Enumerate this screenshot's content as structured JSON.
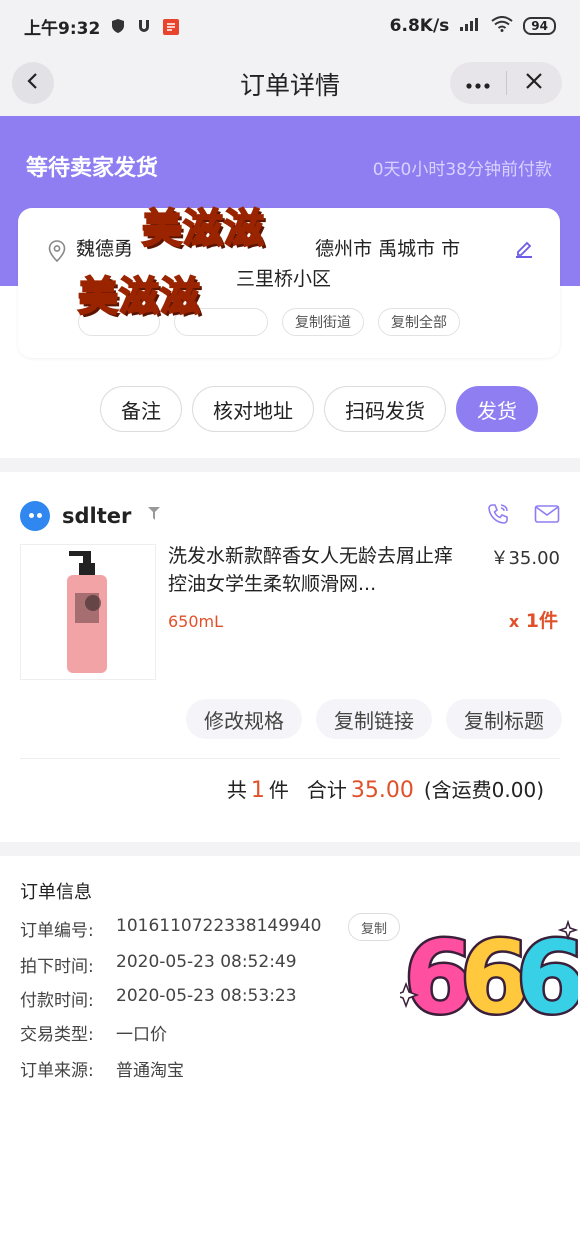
{
  "statusbar": {
    "time": "上午9:32",
    "network": "6.8K/s",
    "battery": "94"
  },
  "nav": {
    "title": "订单详情"
  },
  "order_status": {
    "title": "等待卖家发货",
    "paid_ago": "0天0小时38分钟前付款"
  },
  "address": {
    "line1": "魏德勇 ",
    "line1_tail": " 德州市 禹城市 市",
    "line2_tail": "三里桥小区",
    "buttons": [
      "复制街道",
      "复制全部"
    ]
  },
  "stickers": {
    "top": "美滋滋",
    "bottom": "美滋滋",
    "number": "666"
  },
  "actions": {
    "note": "备注",
    "check_address": "核对地址",
    "scan_ship": "扫码发货",
    "ship": "发货"
  },
  "shop": {
    "name": "sdlter"
  },
  "product": {
    "title": "洗发水新款醉香女人无龄去屑止痒控油女学生柔软顺滑网...",
    "price": "￥35.00",
    "spec": "650mL",
    "qty_prefix": "x",
    "qty": "1件",
    "buttons": [
      "修改规格",
      "复制链接",
      "复制标题"
    ]
  },
  "summary": {
    "count_prefix": "共",
    "count": "1",
    "count_suffix": "件",
    "total_label": "合计",
    "total": "35.00",
    "shipping": "(含运费0.00)"
  },
  "info": {
    "title": "订单信息",
    "copy": "复制",
    "rows": [
      {
        "k": "订单编号:",
        "v": "1016110722338149940"
      },
      {
        "k": "拍下时间:",
        "v": "2020-05-23 08:52:49"
      },
      {
        "k": "付款时间:",
        "v": "2020-05-23 08:53:23"
      },
      {
        "k": "交易类型:",
        "v": "一口价"
      },
      {
        "k": "订单来源:",
        "v": "普通淘宝"
      }
    ]
  },
  "colors": {
    "accent": "#8f7ef2",
    "price_red": "#e0512a",
    "shop_blue": "#2f87ef"
  },
  "icons": [
    "back-arrow-icon",
    "more-dots-icon",
    "close-icon",
    "location-pin-icon",
    "edit-pencil-icon",
    "phone-icon",
    "mail-icon",
    "flag-icon"
  ]
}
